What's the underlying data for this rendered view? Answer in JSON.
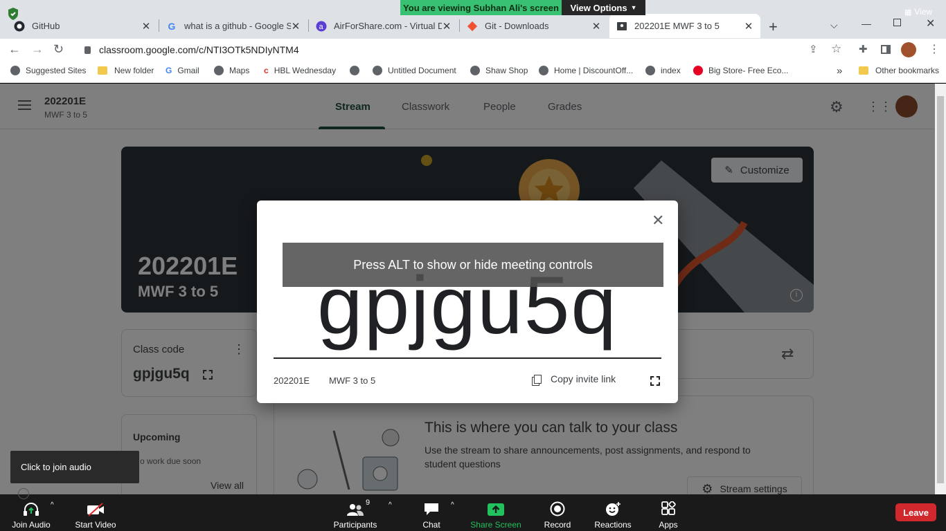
{
  "browser": {
    "tabs": [
      {
        "title": "GitHub"
      },
      {
        "title": "what is a github - Google Se"
      },
      {
        "title": "AirForShare.com - Virtual De"
      },
      {
        "title": "Git - Downloads"
      },
      {
        "title": "202201E MWF 3 to 5"
      }
    ],
    "url": "classroom.google.com/c/NTI3OTk5NDIyNTM4",
    "bookmarks": [
      "Suggested Sites",
      "New folder",
      "Gmail",
      "Maps",
      "HBL Wednesday",
      "",
      "Untitled Document",
      "Shaw Shop",
      "Home | DiscountOff...",
      "index",
      "Big Store- Free Eco..."
    ],
    "other_bookmarks": "Other bookmarks",
    "more": "»"
  },
  "share_banner": {
    "viewing": "You are viewing Subhan Ali's screen",
    "view_options": "View Options",
    "view": "View"
  },
  "classroom": {
    "class_name": "202201E",
    "section": "MWF 3 to 5",
    "nav_tabs": [
      "Stream",
      "Classwork",
      "People",
      "Grades"
    ],
    "customize": "Customize",
    "class_code_label": "Class code",
    "class_code": "gpjgu5q",
    "upcoming_label": "Upcoming",
    "upcoming_text": "o work due soon",
    "view_all": "View all",
    "talk_title": "This is where you can talk to your class",
    "talk_desc": "Use the stream to share announcements, post assignments, and respond to student questions",
    "stream_settings": "Stream settings"
  },
  "modal": {
    "code": "gpjgu5q",
    "class_name": "202201E",
    "section": "MWF 3 to 5",
    "copy_link": "Copy invite link",
    "overlay_hint": "Press ALT to show or hide meeting controls"
  },
  "zoom": {
    "tooltip": "Click to join audio",
    "buttons": [
      "Join Audio",
      "Start Video",
      "Participants",
      "Chat",
      "Share Screen",
      "Record",
      "Reactions",
      "Apps"
    ],
    "participant_count": "9",
    "leave": "Leave",
    "accent_green": "#21c15e",
    "leave_color": "#d1282d"
  }
}
